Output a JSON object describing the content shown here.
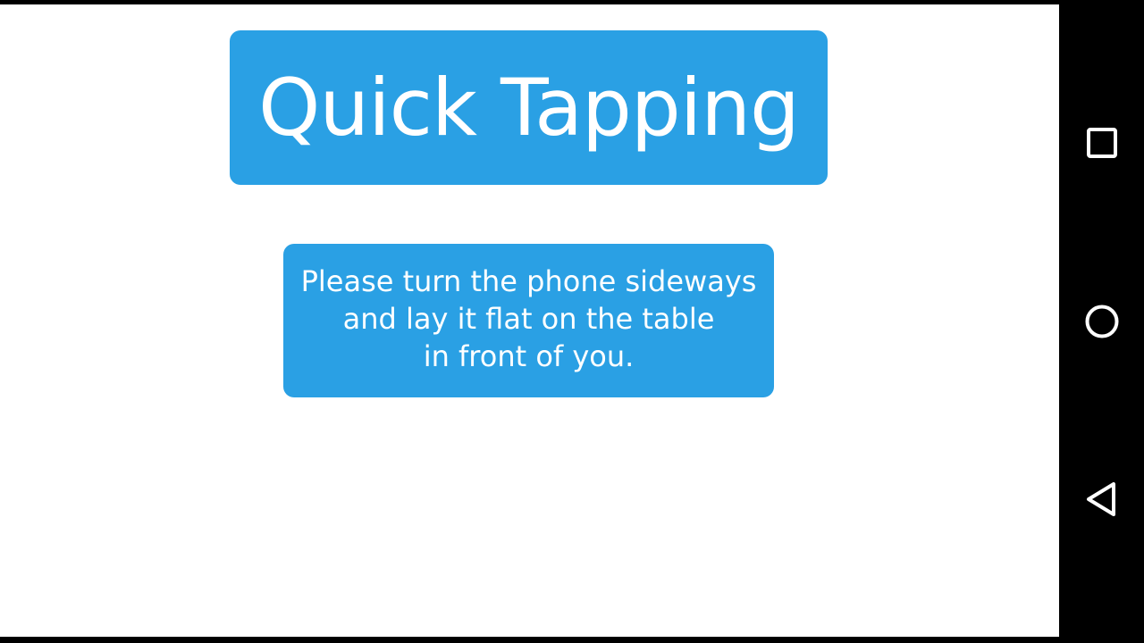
{
  "app": {
    "title": "Quick Tapping",
    "instruction_lines": [
      "Please turn the phone sideways",
      "and lay it flat on the table",
      "in front of you."
    ]
  },
  "navbar": {
    "buttons": [
      {
        "icon": "square-recents-icon"
      },
      {
        "icon": "circle-home-icon"
      },
      {
        "icon": "triangle-back-icon"
      }
    ]
  },
  "colors": {
    "accent": "#2aa0e4",
    "background": "#ffffff",
    "navbar": "#000000",
    "text_on_accent": "#ffffff"
  }
}
